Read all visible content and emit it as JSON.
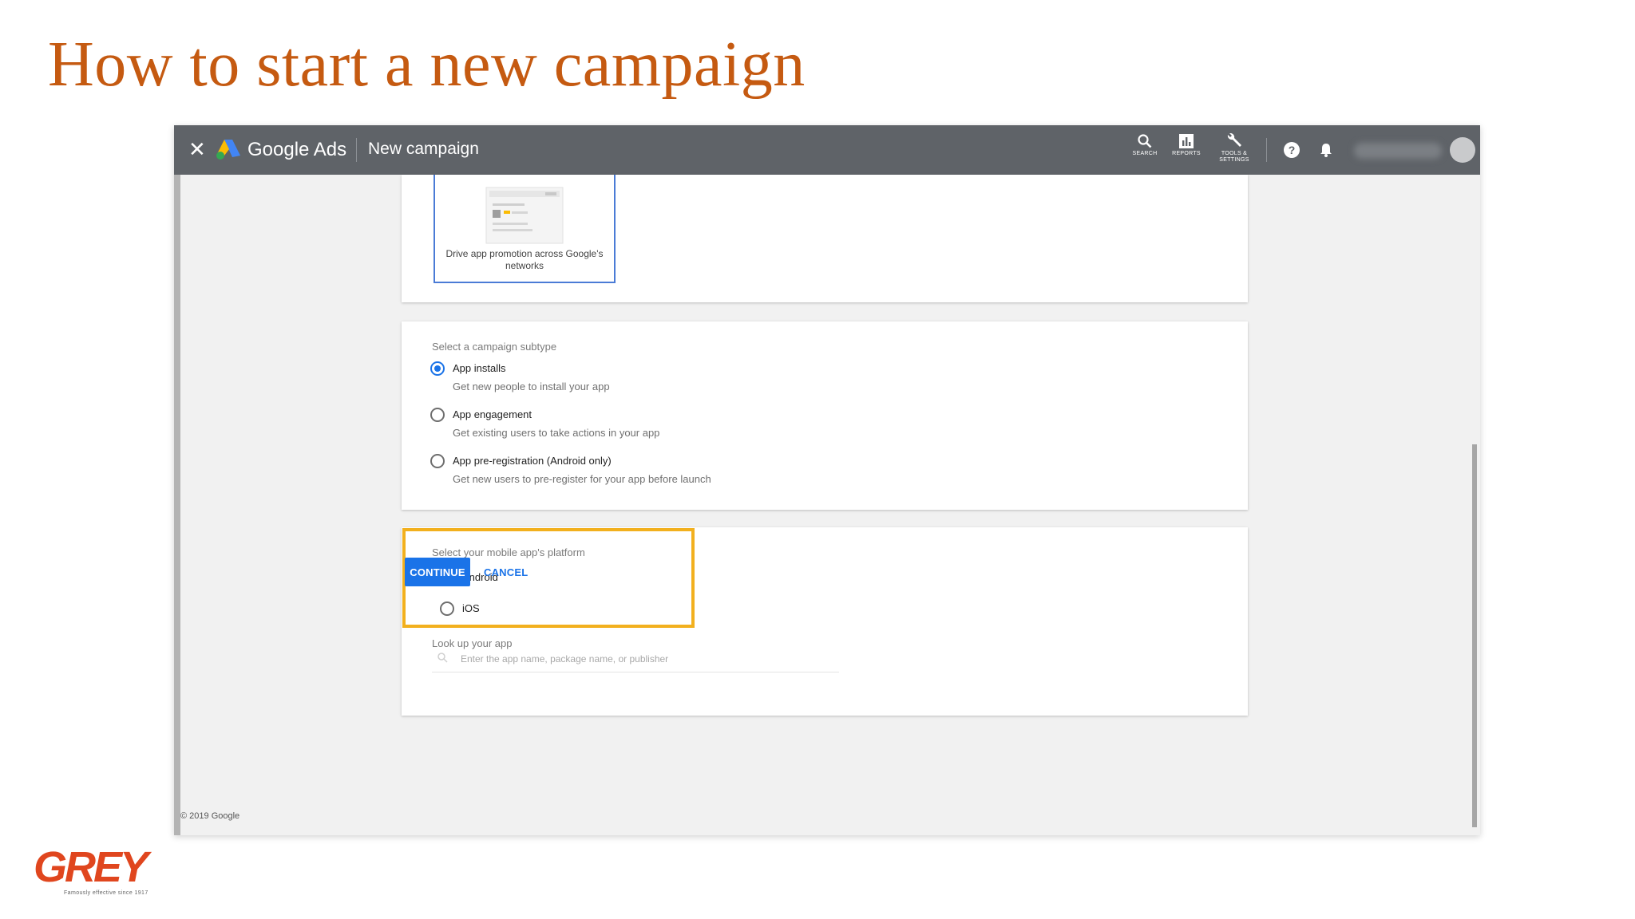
{
  "slide": {
    "title": "How to start a new campaign",
    "logo": {
      "text": "GREY",
      "tagline": "Famously effective since 1917"
    }
  },
  "topbar": {
    "close_icon": "close-icon",
    "brand": "Google Ads",
    "page_title": "New campaign",
    "tools": [
      {
        "label": "SEARCH",
        "icon": "search-icon"
      },
      {
        "label": "REPORTS",
        "icon": "reports-icon"
      },
      {
        "label": "TOOLS & SETTINGS",
        "icon": "wrench-icon"
      }
    ],
    "help_icon": "help-icon",
    "notification_icon": "bell-icon"
  },
  "goal_card": {
    "tile_text": "Drive app promotion across Google's networks"
  },
  "subtype_card": {
    "label": "Select a campaign subtype",
    "options": [
      {
        "title": "App installs",
        "desc": "Get new people to install your app",
        "selected": true
      },
      {
        "title": "App engagement",
        "desc": "Get existing users to take actions in your app",
        "selected": false
      },
      {
        "title": "App pre-registration (Android only)",
        "desc": "Get new users to pre-register for your app before launch",
        "selected": false
      }
    ]
  },
  "platform_card": {
    "label": "Select your mobile app's platform",
    "options": [
      {
        "title": "Android",
        "selected": false
      },
      {
        "title": "iOS",
        "selected": false
      }
    ],
    "lookup_label": "Look up your app",
    "search_placeholder": "Enter the app name, package name, or publisher",
    "highlight_color": "#f2b01e"
  },
  "actions": {
    "continue": "CONTINUE",
    "cancel": "CANCEL"
  },
  "footer": "© 2019 Google",
  "colors": {
    "title": "#c55a11",
    "topbar": "#5f6368",
    "accent": "#1a73e8",
    "grey_logo": "#e0461e"
  }
}
